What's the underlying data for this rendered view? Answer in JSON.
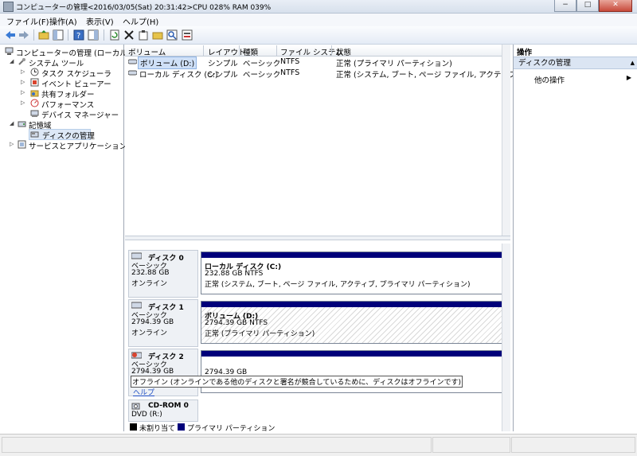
{
  "window": {
    "title": "コンピューターの管理<2016/03/05(Sat) 20:31:42>CPU 028% RAM 039%",
    "buttons": {
      "minimize": "−",
      "maximize": "□",
      "close": "✕"
    }
  },
  "menu": [
    "ファイル(F)",
    "操作(A)",
    "表示(V)",
    "ヘルプ(H)"
  ],
  "toolbar": {
    "icons": [
      "back-icon",
      "forward-icon",
      "up-folder-icon",
      "show-hide-tree-icon",
      "help-icon",
      "properties-pane-icon",
      "refresh-icon",
      "delete-icon",
      "properties-icon",
      "open-icon",
      "search-icon",
      "export-icon"
    ]
  },
  "tree": {
    "root": "コンピューターの管理 (ローカル)",
    "system_tools": "システム ツール",
    "task_scheduler": "タスク スケジューラ",
    "event_viewer": "イベント ビューアー",
    "shared_folders": "共有フォルダー",
    "performance": "パフォーマンス",
    "device_manager": "デバイス マネージャー",
    "storage": "記憶域",
    "disk_management": "ディスクの管理",
    "services_apps": "サービスとアプリケーション"
  },
  "volumes": {
    "headers": [
      "ボリューム",
      "レイアウト",
      "種類",
      "ファイル システム",
      "状態"
    ],
    "rows": [
      {
        "name": "ボリューム (D:)",
        "layout": "シンプル",
        "type": "ベーシック",
        "fs": "NTFS",
        "status": "正常 (プライマリ パーティション)"
      },
      {
        "name": "ローカル ディスク (C:)",
        "layout": "シンプル",
        "type": "ベーシック",
        "fs": "NTFS",
        "status": "正常 (システム, ブート, ページ ファイル, アクティブ, プライマリ"
      }
    ]
  },
  "disks": {
    "disk0": {
      "name": "ディスク 0",
      "type": "ベーシック",
      "size": "232.88 GB",
      "state": "オンライン",
      "part_name": "ローカル ディスク  (C:)",
      "part_size": "232.88 GB NTFS",
      "part_status": "正常 (システム, ブート, ページ ファイル, アクティブ, プライマリ パーティション)"
    },
    "disk1": {
      "name": "ディスク 1",
      "type": "ベーシック",
      "size": "2794.39 GB",
      "state": "オンライン",
      "part_name": "ボリューム  (D:)",
      "part_size": "2794.39 GB NTFS",
      "part_status": "正常 (プライマリ パーティション)"
    },
    "disk2": {
      "name": "ディスク 2",
      "type": "ベーシック",
      "size": "2794.39 GB",
      "state": "オフライン (オンラインである他のディスクと署名が競合しているために、ディスクはオフラインです)",
      "help": "ヘルプ",
      "part_size": "2794.39 GB"
    },
    "cdrom": {
      "name": "CD-ROM 0",
      "drive": "DVD (R:)"
    }
  },
  "legend": {
    "unallocated": "未割り当て",
    "primary": "プライマリ パーティション",
    "unallocated_color": "#000000",
    "primary_color": "#00007a"
  },
  "actions": {
    "header": "操作",
    "selected": "ディスクの管理",
    "other": "他の操作"
  }
}
